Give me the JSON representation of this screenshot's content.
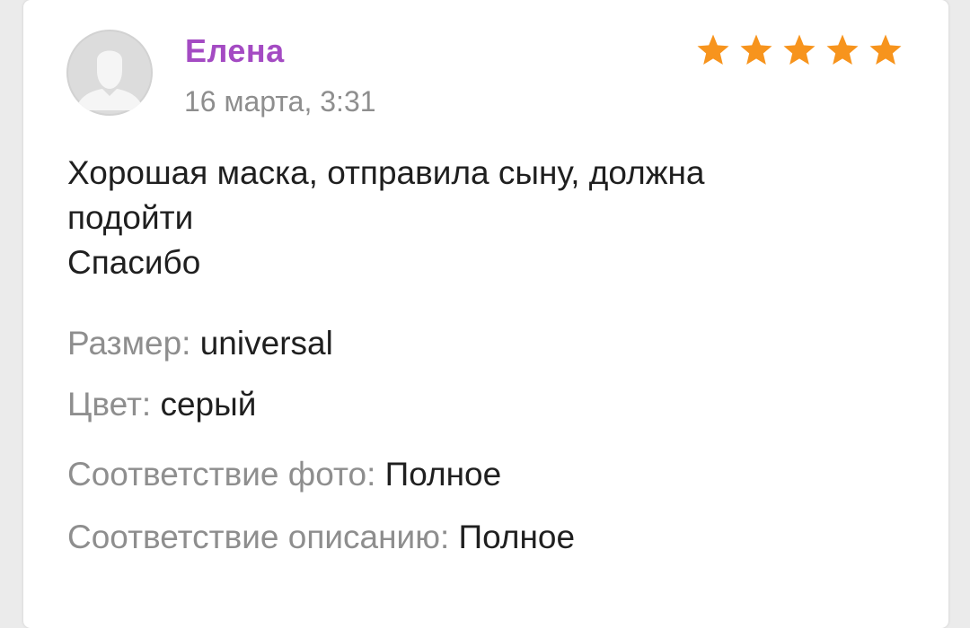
{
  "review": {
    "author": "Елена",
    "date": "16 марта, 3:31",
    "rating": 5,
    "rating_max": 5,
    "star_color": "#f7941d",
    "author_color": "#a44bc3",
    "avatar_icon": "person-placeholder-icon",
    "text_lines": [
      "Хорошая маска, отправила сыну, должна",
      "подойти",
      "Спасибо"
    ]
  },
  "attributes": {
    "size_label": "Размер: ",
    "size_value": "universal",
    "color_label": "Цвет: ",
    "color_value": "серый",
    "photo_match_label": "Соответствие фото: ",
    "photo_match_value": "Полное",
    "description_match_label": "Соответствие описанию: ",
    "description_match_value": "Полное"
  }
}
